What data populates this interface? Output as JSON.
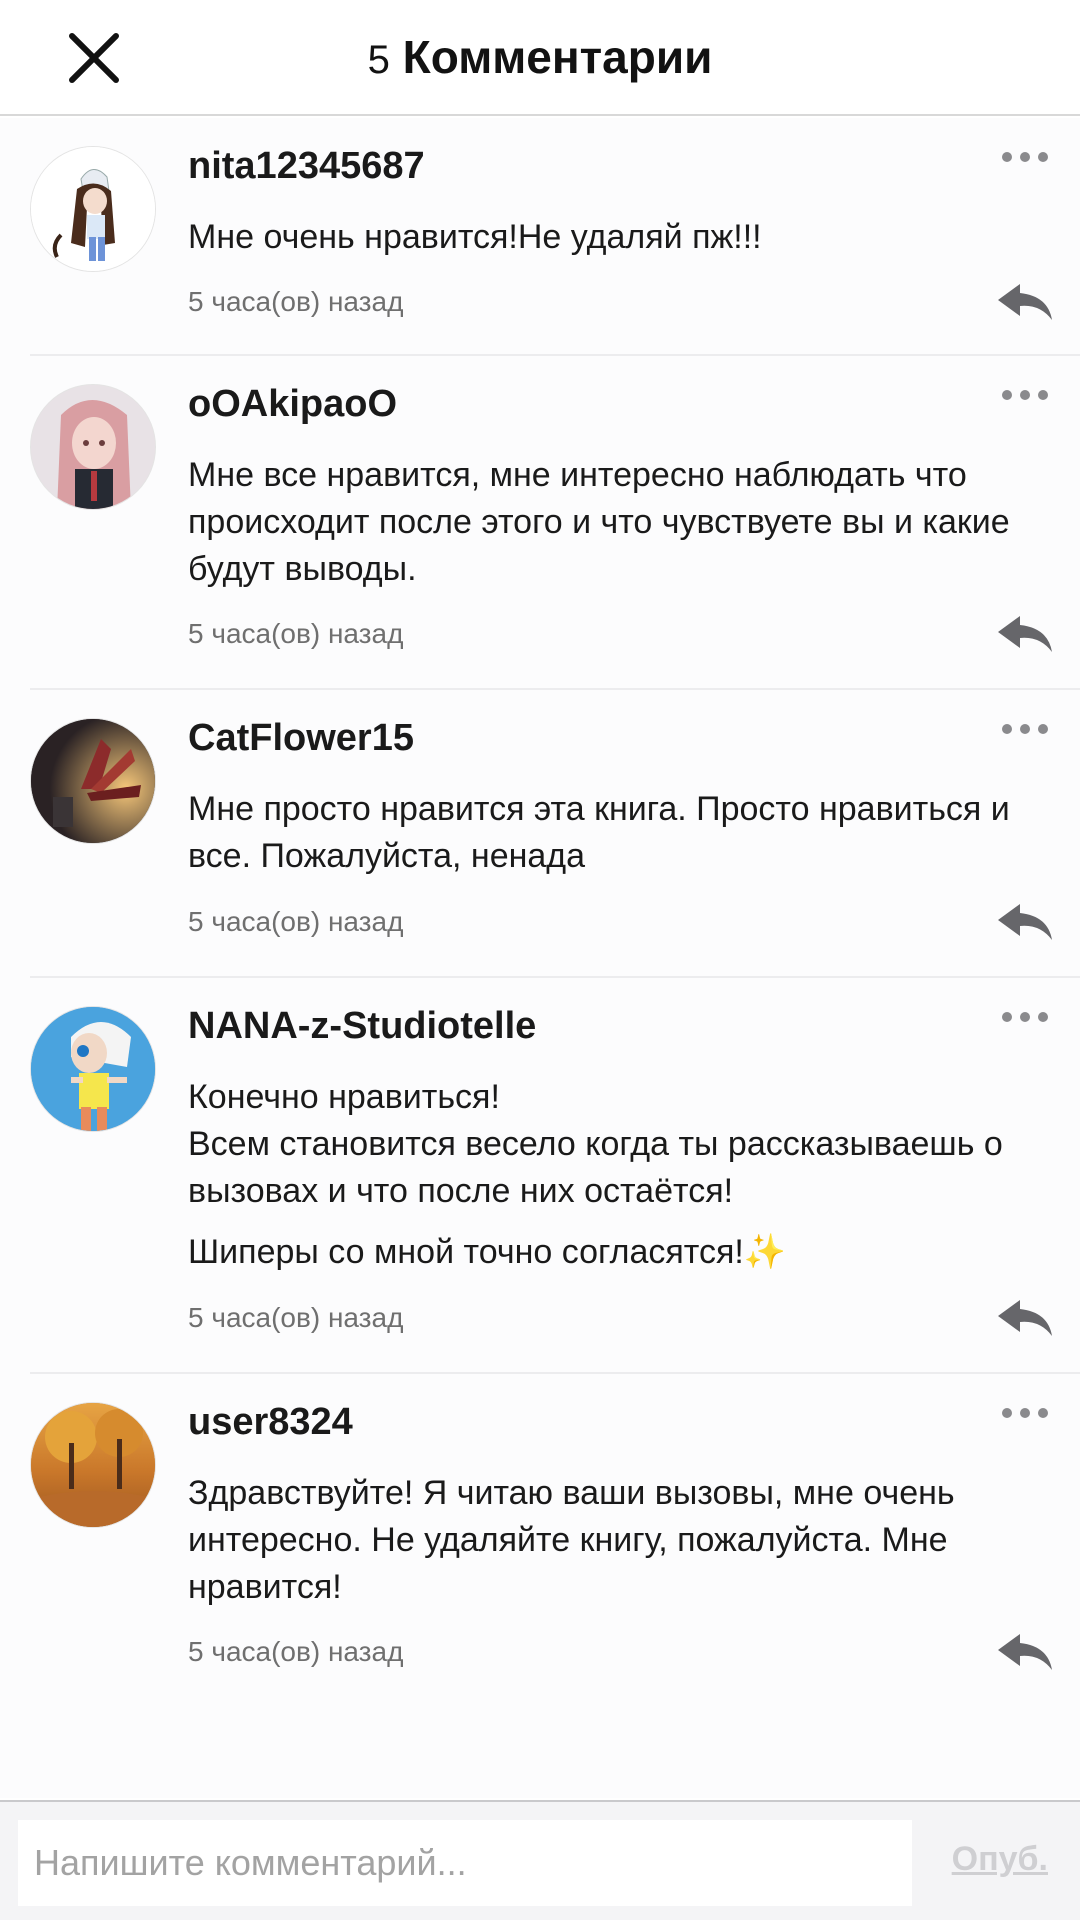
{
  "header": {
    "count": "5",
    "title": "Комментарии"
  },
  "comments": [
    {
      "username": "nita12345687",
      "text": [
        "Мне очень нравится!Не удаляй пж!!!"
      ],
      "time": "5 часа(ов) назад"
    },
    {
      "username": "oOAkipaoO",
      "text": [
        "Мне все нравится, мне интересно наблюдать что происходит после этого и что чувствуете вы и какие будут выводы."
      ],
      "time": "5 часа(ов) назад"
    },
    {
      "username": "CatFlower15",
      "text": [
        "Мне просто нравится эта книга. Просто нравиться и все. Пожалуйста, ненада"
      ],
      "time": "5 часа(ов) назад"
    },
    {
      "username": "NANA-z-Studiotelle",
      "text": [
        "Конечно нравиться!",
        "Всем становится весело когда ты рассказываешь о вызовах и что после них остаётся!",
        "Шиперы со мной точно согласятся!",
        "✨"
      ],
      "time": "5 часа(ов) назад"
    },
    {
      "username": "user8324",
      "text": [
        "Здравствуйте! Я читаю ваши вызовы, мне очень интересно. Не удаляйте книгу, пожалуйста. Мне нравится!"
      ],
      "time": "5 часа(ов) назад"
    }
  ],
  "footer": {
    "placeholder": "Напишите комментарий...",
    "publish_label": "Опуб."
  },
  "icons": {
    "close": "close-icon",
    "more": "more-dots-icon",
    "reply": "reply-arrow-icon"
  },
  "colors": {
    "text": "#1a1a1a",
    "meta": "#6f6f6f",
    "publish_disabled": "#cfcfd2",
    "icon": "#6b6b6d"
  }
}
